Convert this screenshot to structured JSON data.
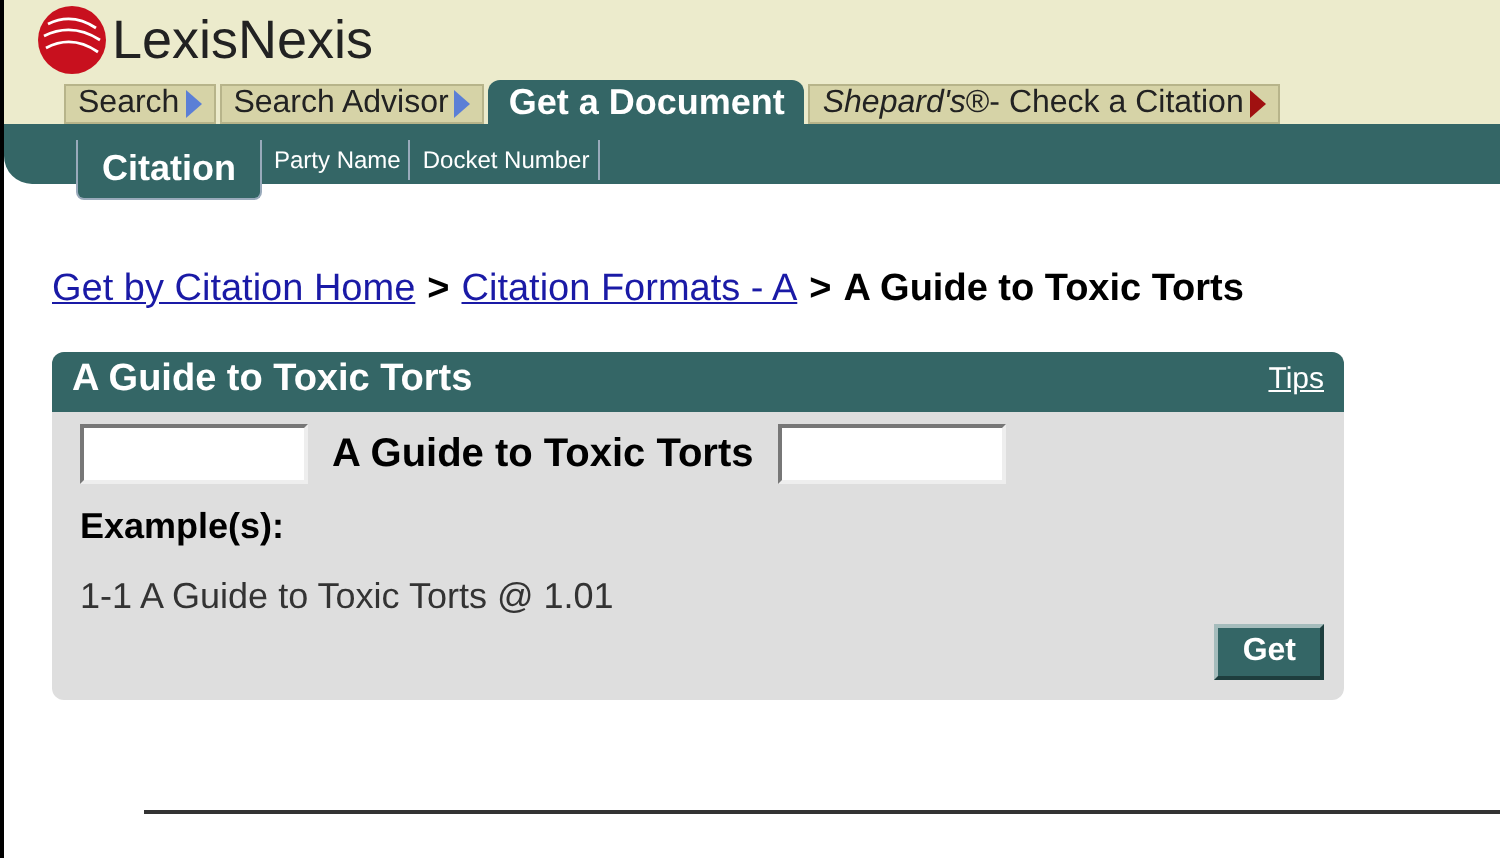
{
  "brand": {
    "name": "LexisNexis"
  },
  "tabs": [
    {
      "label": "Search",
      "selected": false,
      "color": "#5b7fd6"
    },
    {
      "label": "Search Advisor",
      "selected": false,
      "color": "#5b7fd6"
    },
    {
      "label": "Get a Document",
      "selected": true
    },
    {
      "label": "*Shepard's*®- Check a Citation",
      "selected": false,
      "color": "#a01010"
    }
  ],
  "subtabs": [
    {
      "label": "Citation",
      "selected": true
    },
    {
      "label": "Party Name",
      "selected": false
    },
    {
      "label": "Docket Number",
      "selected": false
    }
  ],
  "breadcrumb": [
    {
      "label": "Get by Citation Home",
      "kind": "link"
    },
    {
      "label": ">",
      "kind": "separator"
    },
    {
      "label": "Citation Formats - A",
      "kind": "link"
    },
    {
      "label": ">",
      "kind": "separator"
    },
    {
      "label": "A Guide to Toxic Torts",
      "kind": "current"
    }
  ],
  "panel": {
    "title": "A Guide to Toxic Torts",
    "tips": "Tips",
    "field_label": "A Guide to Toxic Torts",
    "examples_heading": "Example(s):",
    "example": "1-1 A Guide to Toxic Torts @ 1.01",
    "button": "Get"
  }
}
